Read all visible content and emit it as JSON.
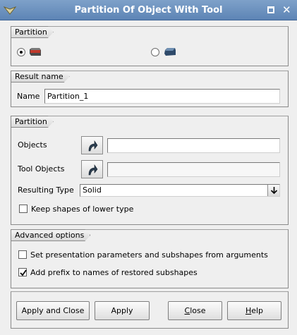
{
  "window": {
    "title": "Partition Of Object With Tool"
  },
  "partition_type": {
    "group_label": "Partition",
    "options": [
      {
        "icon": "partition-object-icon",
        "selected": true
      },
      {
        "icon": "partition-plane-icon",
        "selected": false
      }
    ]
  },
  "result": {
    "group_label": "Result name",
    "name_label": "Name",
    "name_value": "Partition_1"
  },
  "partition": {
    "group_label": "Partition",
    "objects_label": "Objects",
    "objects_value": "",
    "tool_objects_label": "Tool Objects",
    "tool_objects_value": "",
    "resulting_type_label": "Resulting Type",
    "resulting_type_value": "Solid",
    "keep_shapes_label": "Keep shapes of lower type",
    "keep_shapes_checked": false
  },
  "advanced": {
    "group_label": "Advanced options",
    "set_params_label": "Set presentation parameters and subshapes from arguments",
    "set_params_checked": false,
    "add_prefix_label": "Add prefix to names of restored subshapes",
    "add_prefix_checked": true
  },
  "buttons": {
    "apply_close": "Apply and Close",
    "apply": "Apply",
    "close_prefix": "",
    "close_mnemonic": "C",
    "close_rest": "lose",
    "help_prefix": "",
    "help_mnemonic": "H",
    "help_rest": "elp"
  },
  "colors": {
    "titlebar": "#6a8fbf",
    "background": "#efefef",
    "shape_red": "#c0392b",
    "shape_blue": "#3c5a7a"
  }
}
